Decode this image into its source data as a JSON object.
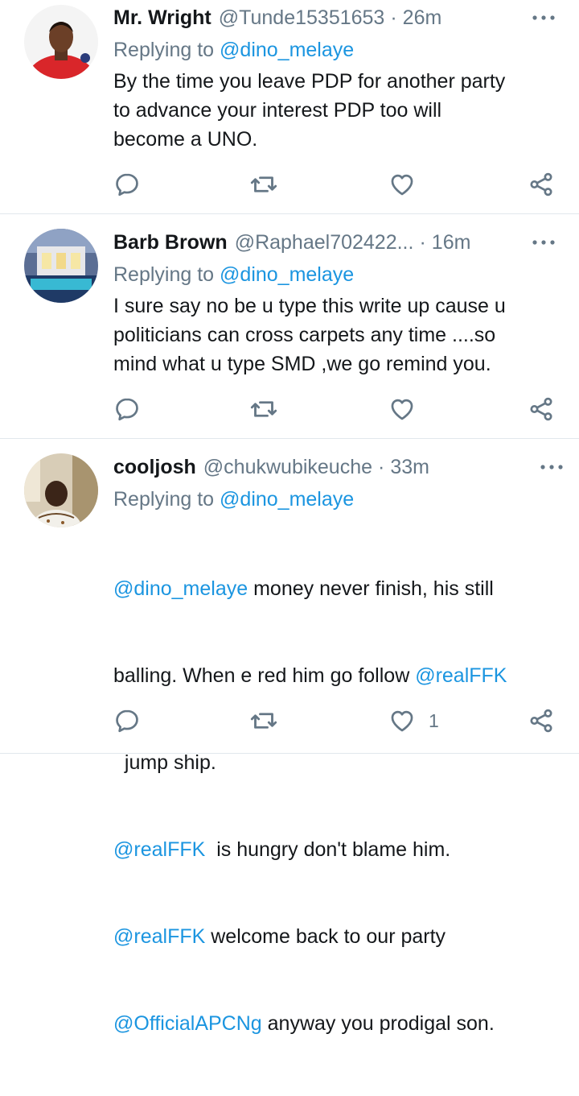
{
  "tweets": [
    {
      "name": "Mr. Wright",
      "handle": "@Tunde15351653",
      "sep": "·",
      "time": "26m",
      "reply_prefix": "Replying to",
      "reply_to": "@dino_melaye",
      "body_lines": [
        "By the time you leave PDP for another party",
        "to advance your interest PDP too will",
        "become a UNO."
      ],
      "like_count": ""
    },
    {
      "name": "Barb Brown",
      "handle": "@Raphael702422...",
      "sep": "·",
      "time": "16m",
      "reply_prefix": "Replying to",
      "reply_to": "@dino_melaye",
      "body_lines": [
        "I sure say no be u type this write up cause u",
        "politicians can cross carpets any time ....so",
        "mind what u type SMD ,we go remind you."
      ],
      "like_count": ""
    },
    {
      "name": "cooljosh",
      "handle": "@chukwubikeuche",
      "sep": "·",
      "time": "33m",
      "reply_prefix": "Replying to",
      "reply_to": "@dino_melaye",
      "body": {
        "m1": "@dino_melaye",
        "t1": " money never finish, his still",
        "t2": "balling. When e red him go follow ",
        "m2": "@realFFK",
        "t3": "  jump ship.",
        "m3": "@realFFK",
        "t4": "  is hungry don't blame him.",
        "m4": "@realFFK",
        "t5": " welcome back to our party",
        "m5": "@OfficialAPCNg",
        "t6": " anyway you prodigal son."
      },
      "like_count": "1"
    }
  ],
  "colors": {
    "text": "#14171a",
    "secondary": "#657786",
    "link": "#1b95e0",
    "divider": "#e1e8ed"
  },
  "icons": [
    "more-icon",
    "reply-icon",
    "retweet-icon",
    "like-icon",
    "share-icon"
  ]
}
